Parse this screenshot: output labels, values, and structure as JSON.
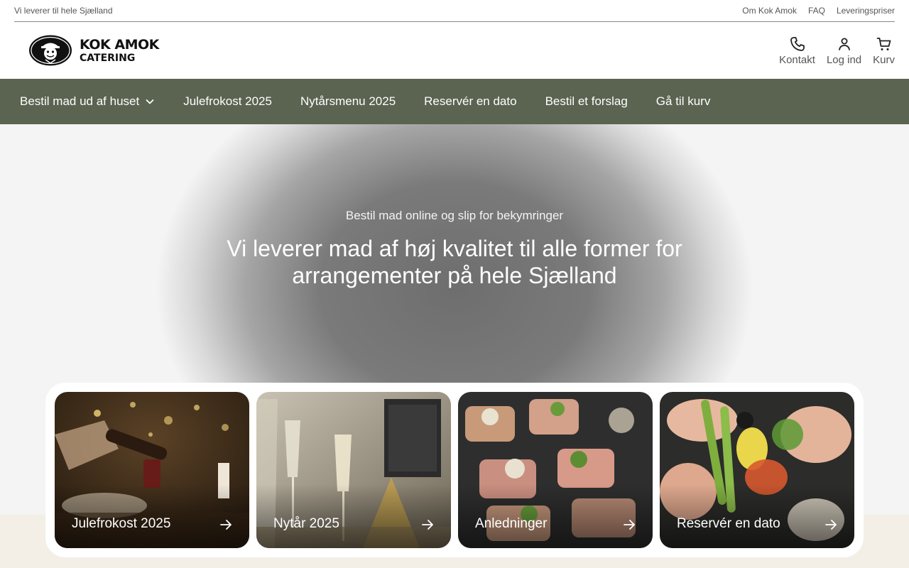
{
  "topbar": {
    "tagline": "Vi leverer til hele Sjælland",
    "links": [
      "Om Kok Amok",
      "FAQ",
      "Leveringspriser"
    ]
  },
  "brand": {
    "line1": "KOK AMOK",
    "line2": "CATERING"
  },
  "header_actions": [
    {
      "label": "Kontakt",
      "icon": "phone-icon"
    },
    {
      "label": "Log ind",
      "icon": "user-icon"
    },
    {
      "label": "Kurv",
      "icon": "cart-icon"
    }
  ],
  "nav": [
    "Bestil mad ud af huset",
    "Julefrokost 2025",
    "Nytårsmenu 2025",
    "Reservér en dato",
    "Bestil et forslag",
    "Gå til kurv"
  ],
  "hero": {
    "subtitle": "Bestil mad online og slip for bekymringer",
    "title": "Vi leverer mad af høj kvalitet til alle former for arrangementer på hele Sjælland"
  },
  "cards": [
    {
      "label": "Julefrokost 2025"
    },
    {
      "label": "Nytår 2025"
    },
    {
      "label": "Anledninger"
    },
    {
      "label": "Reservér en dato"
    }
  ],
  "colors": {
    "nav_bg": "#5a6451",
    "beige_band": "#f3efe6"
  }
}
